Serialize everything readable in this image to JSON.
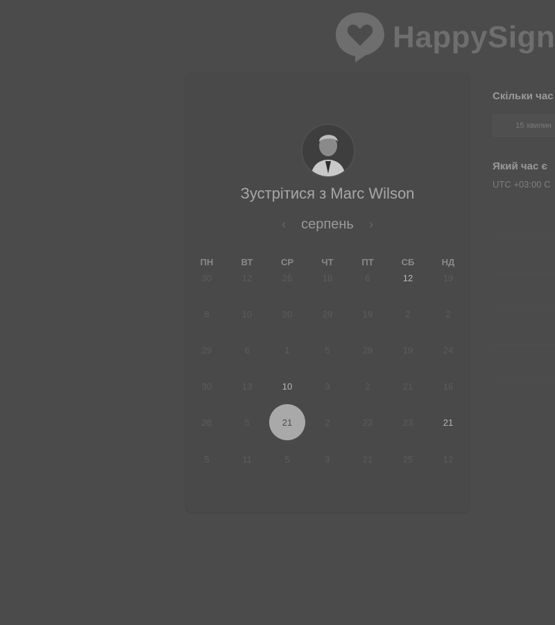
{
  "brand": {
    "name": "HappySign",
    "icon": "heart-speech-bubble-icon"
  },
  "host": {
    "title": "Зустрітися з Marc Wilson",
    "avatar": "avatar-photo"
  },
  "calendar": {
    "month": "серпень",
    "prev_icon": "chevron-left-icon",
    "next_icon": "chevron-right-icon",
    "weekdays": [
      "ПН",
      "ВТ",
      "СР",
      "ЧТ",
      "ПТ",
      "СБ",
      "НД"
    ],
    "weeks": [
      [
        {
          "d": "30",
          "s": "off"
        },
        {
          "d": "12",
          "s": "off"
        },
        {
          "d": "26",
          "s": "off"
        },
        {
          "d": "18",
          "s": "off"
        },
        {
          "d": "6",
          "s": "off"
        },
        {
          "d": "12",
          "s": "available"
        },
        {
          "d": "19",
          "s": "off"
        }
      ],
      [
        {
          "d": "8",
          "s": "off"
        },
        {
          "d": "10",
          "s": "off"
        },
        {
          "d": "20",
          "s": "off"
        },
        {
          "d": "29",
          "s": "off"
        },
        {
          "d": "19",
          "s": "off"
        },
        {
          "d": "2",
          "s": "off"
        },
        {
          "d": "2",
          "s": "off"
        }
      ],
      [
        {
          "d": "29",
          "s": "off"
        },
        {
          "d": "6",
          "s": "off"
        },
        {
          "d": "1",
          "s": "off"
        },
        {
          "d": "5",
          "s": "off"
        },
        {
          "d": "29",
          "s": "off"
        },
        {
          "d": "19",
          "s": "off"
        },
        {
          "d": "24",
          "s": "off"
        }
      ],
      [
        {
          "d": "30",
          "s": "off"
        },
        {
          "d": "13",
          "s": "off"
        },
        {
          "d": "10",
          "s": "available"
        },
        {
          "d": "3",
          "s": "off"
        },
        {
          "d": "2",
          "s": "off"
        },
        {
          "d": "21",
          "s": "off"
        },
        {
          "d": "16",
          "s": "off"
        }
      ],
      [
        {
          "d": "28",
          "s": "off"
        },
        {
          "d": "5",
          "s": "off"
        },
        {
          "d": "21",
          "s": "selected"
        },
        {
          "d": "2",
          "s": "off"
        },
        {
          "d": "23",
          "s": "off"
        },
        {
          "d": "23",
          "s": "off"
        },
        {
          "d": "21",
          "s": "available"
        }
      ],
      [
        {
          "d": "5",
          "s": "off"
        },
        {
          "d": "11",
          "s": "off"
        },
        {
          "d": "5",
          "s": "off"
        },
        {
          "d": "3",
          "s": "off"
        },
        {
          "d": "21",
          "s": "off"
        },
        {
          "d": "25",
          "s": "off"
        },
        {
          "d": "12",
          "s": "off"
        }
      ]
    ]
  },
  "booking": {
    "duration_question": "Скільки час",
    "duration_option": "15 хвилин",
    "timezone_question": "Який час є",
    "timezone_value": "UTC +03:00 C"
  },
  "colors": {
    "overlay": "#4b4b4b",
    "selected_day": "#a9a9a9"
  }
}
